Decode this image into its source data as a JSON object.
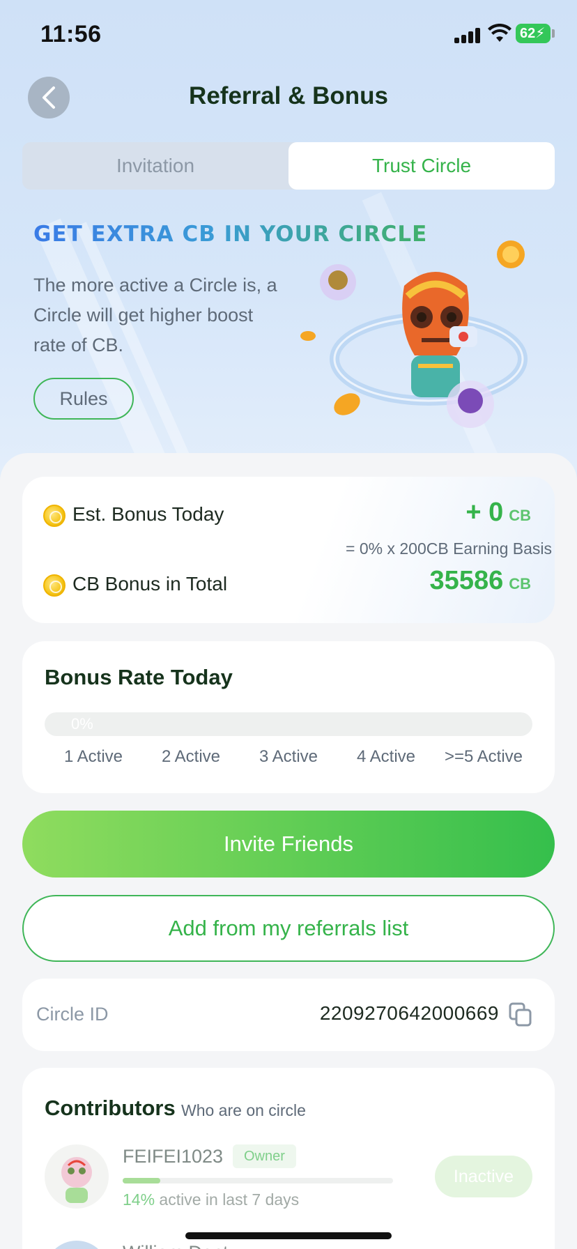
{
  "status_bar": {
    "time": "11:56",
    "battery": "62"
  },
  "header": {
    "title": "Referral & Bonus"
  },
  "tabs": [
    {
      "label": "Invitation",
      "active": false
    },
    {
      "label": "Trust Circle",
      "active": true
    }
  ],
  "promo": {
    "title": "GET EXTRA CB IN YOUR CIRCLE",
    "description": "The more active a Circle is, a Circle will get higher boost rate of CB.",
    "rules_label": "Rules"
  },
  "bonus": {
    "est_today_label": "Est. Bonus Today",
    "est_today_value": "+ 0",
    "unit": "CB",
    "basis": "= 0% x 200CB Earning Basis",
    "total_label": "CB Bonus in Total",
    "total_value": "35586"
  },
  "bonus_rate": {
    "title": "Bonus Rate Today",
    "progress_text": "0%",
    "progress_fraction": 0.0,
    "levels": [
      "1 Active",
      "2 Active",
      "3 Active",
      "4 Active",
      ">=5 Active"
    ]
  },
  "actions": {
    "invite_label": "Invite Friends",
    "add_label": "Add from my referrals list"
  },
  "circle": {
    "label": "Circle ID",
    "id": "2209270642000669"
  },
  "contributors": {
    "title": "Contributors",
    "subtitle": "Who are on circle",
    "members": [
      {
        "name": "FEIFEI1023",
        "badge": "Owner",
        "activity_pct": "14%",
        "activity_fraction": 0.14,
        "activity_text": " active in last 7 days",
        "status": "Inactive"
      },
      {
        "name": "William Dent"
      }
    ]
  },
  "colors": {
    "accent": "#35b34a",
    "hero_bg": "#cfe1f7",
    "page_bg": "#f4f5f7"
  }
}
